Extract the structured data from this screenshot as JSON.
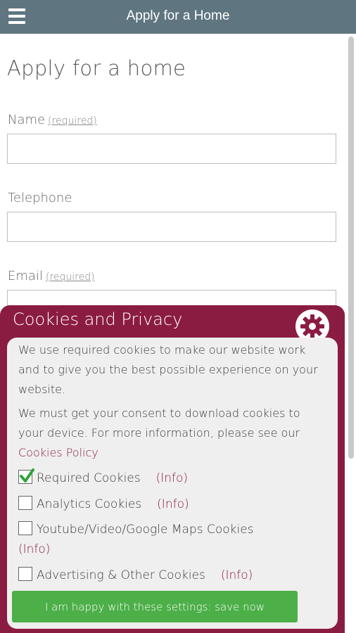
{
  "header": {
    "title": "Apply for a Home",
    "menu_icon": "hamburger-menu-icon"
  },
  "form": {
    "page_title": "Apply for a home",
    "fields": [
      {
        "label": "Name",
        "required_note": "(required)",
        "value": "",
        "placeholder": ""
      },
      {
        "label": "Telephone",
        "required_note": "",
        "value": "",
        "placeholder": ""
      },
      {
        "label": "Email",
        "required_note": "(required)",
        "value": "",
        "placeholder": ""
      }
    ]
  },
  "cookies": {
    "title": "Cookies and Privacy",
    "settings_icon": "gear-icon",
    "intro": "We use required cookies to make our website work and to give you the best possible experience on your website.",
    "consent_text": "We must get your consent to download cookies to your device. For more information, please see our ",
    "policy_link": "Cookies Policy",
    "options": [
      {
        "label": "Required Cookies",
        "info": "(Info)",
        "checked": true
      },
      {
        "label": "Analytics Cookies",
        "info": "(Info)",
        "checked": false
      },
      {
        "label": "Youtube/Video/Google Maps Cookies",
        "info": "(Info)",
        "checked": false
      },
      {
        "label": "Advertising & Other Cookies",
        "info": "(Info)",
        "checked": false
      }
    ],
    "save_button": "I am happy with these settings: save now",
    "colors": {
      "panel": "#8b1c41",
      "button": "#4caf48",
      "header_bar": "#5f7681"
    }
  }
}
